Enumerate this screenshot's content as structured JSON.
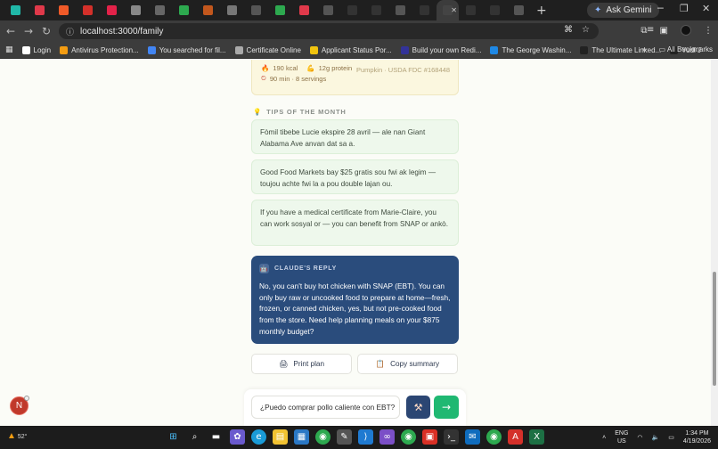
{
  "browser": {
    "tabs": [
      {
        "icon": "perplexity-icon",
        "color": "#20b8a8"
      },
      {
        "icon": "pocket-icon",
        "color": "#e0394a"
      },
      {
        "icon": "orange-app-icon",
        "color": "#f05a28"
      },
      {
        "icon": "acrobat-icon",
        "color": "#d4302a"
      },
      {
        "icon": "heading-icon",
        "color": "#e32249"
      },
      {
        "icon": "gmail-icon",
        "color": "#888888"
      },
      {
        "icon": "chart-icon",
        "color": "#666666"
      },
      {
        "icon": "drive-icon",
        "color": "#2da94f"
      },
      {
        "icon": "dots-icon",
        "color": "#c2571d"
      },
      {
        "icon": "slash-icon",
        "color": "#777777"
      },
      {
        "icon": "github-icon",
        "color": "#555555"
      },
      {
        "icon": "drive-icon",
        "color": "#2da94f"
      },
      {
        "icon": "pocket-icon",
        "color": "#e0394a"
      },
      {
        "icon": "openai-icon",
        "color": "#555555"
      },
      {
        "icon": "delta-icon",
        "color": "#333333"
      },
      {
        "icon": "delta-icon",
        "color": "#333333"
      },
      {
        "icon": "openai-icon",
        "color": "#555555"
      },
      {
        "icon": "delta-icon",
        "color": "#333333"
      },
      {
        "icon": "claude-icon",
        "color": "#444444",
        "active": true
      },
      {
        "icon": "delta-icon",
        "color": "#333333"
      },
      {
        "icon": "delta-icon",
        "color": "#333333"
      },
      {
        "icon": "openai-icon",
        "color": "#555555"
      }
    ],
    "ask_gemini": "Ask Gemini",
    "url": "localhost:3000/family",
    "bookmarks": [
      {
        "label": "Login",
        "color": "#ffffff"
      },
      {
        "label": "Antivirus Protection...",
        "color": "#f39c12"
      },
      {
        "label": "You searched for fil...",
        "color": "#4285f4"
      },
      {
        "label": "Certificate Online",
        "color": "#aaaaaa"
      },
      {
        "label": "Applicant Status Por...",
        "color": "#f1c40f"
      },
      {
        "label": "Build your own Redi...",
        "color": "#333399"
      },
      {
        "label": "The George Washin...",
        "color": "#1e88e5"
      },
      {
        "label": "The Ultimate Linked...",
        "color": "#222222"
      },
      {
        "label": "Yudi J",
        "color": "#222222"
      }
    ],
    "all_bookmarks": "All Bookmarks"
  },
  "recipe": {
    "calories": "190 kcal",
    "protein": "12g protein",
    "source": "Pumpkin · USDA FDC #168448",
    "time": "90 min · 8 servings"
  },
  "tips": {
    "title": "TIPS OF THE MONTH",
    "items": [
      "Fòmil tibebe Lucie ekspire 28 avril — ale nan Giant Alabama Ave anvan dat sa a.",
      "Good Food Markets bay $25 gratis sou fwi ak legim — toujou achte fwi la a pou double lajan ou.",
      "If you have a medical certificate from Marie-Claire, you can work sosyal or — you can benefit from SNAP or ankò."
    ]
  },
  "reply": {
    "title": "CLAUDE'S REPLY",
    "body": "No, you can't buy hot chicken with SNAP (EBT). You can only buy raw or uncooked food to prepare at home—fresh, frozen, or canned chicken, yes, but not pre-cooked food from the store. Need help planning meals on your $875 monthly budget?"
  },
  "actions": {
    "print": "Print plan",
    "copy": "Copy summary"
  },
  "composer": {
    "value": "¿Puedo comprar pollo caliente con EBT?"
  },
  "user": {
    "initial": "N"
  },
  "taskbar": {
    "weather": "52°",
    "lang_line1": "ENG",
    "lang_line2": "US",
    "time": "1:34 PM",
    "date": "4/19/2026"
  }
}
